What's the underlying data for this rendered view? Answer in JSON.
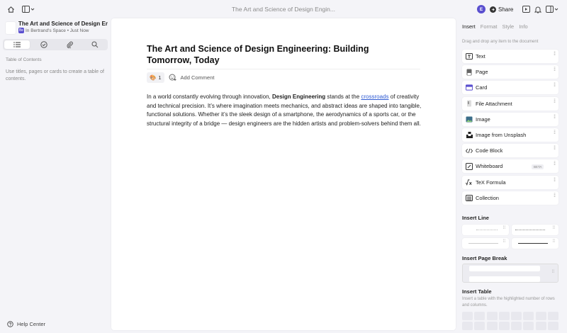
{
  "topbar": {
    "doc_title": "The Art and Science of Design Engin...",
    "avatar_letter": "E",
    "share_label": "Share"
  },
  "sidebar": {
    "doc_name": "The Art and Science of Design Eng...",
    "space_badge": "Be",
    "doc_meta": "In Bertrand's Space • Just Now",
    "toc_title": "Table of Contents",
    "toc_empty": "Use titles, pages or cards to create a table of contents.",
    "help_label": "Help Center"
  },
  "editor": {
    "title": "The Art and Science of Design Engineering: Building Tomorrow, Today",
    "reaction_emoji": "🎨",
    "reaction_count": "1",
    "add_comment": "Add Comment",
    "para_1": "In a world constantly evolving through innovation, ",
    "para_bold": "Design Engineering",
    "para_2": " stands at the ",
    "para_link": "crossroads",
    "para_3": " of creativity and technical precision. It’s where imagination meets mechanics, and abstract ideas are shaped into tangible, functional solutions. Whether it’s the sleek design of a smartphone, the aerodynamics of a sports car, or the structural integrity of a bridge — design engineers are the hidden artists and problem-solvers behind them all."
  },
  "panel": {
    "tabs": [
      "Insert",
      "Format",
      "Style",
      "Info"
    ],
    "hint": "Drag and drop any item to the document",
    "items": [
      {
        "label": "Text",
        "icon": "text-icon"
      },
      {
        "label": "Page",
        "icon": "page-icon"
      },
      {
        "label": "Card",
        "icon": "card-icon"
      },
      {
        "label": "File Attachment",
        "icon": "paperclip-icon"
      },
      {
        "label": "Image",
        "icon": "image-icon"
      },
      {
        "label": "Image from Unsplash",
        "icon": "unsplash-icon"
      },
      {
        "label": "Code Block",
        "icon": "code-icon"
      },
      {
        "label": "Whiteboard",
        "icon": "whiteboard-icon"
      },
      {
        "label": "TeX Formula",
        "icon": "formula-icon"
      },
      {
        "label": "Collection",
        "icon": "collection-icon"
      }
    ],
    "whiteboard_badge": "BETA",
    "insert_line": "Insert Line",
    "insert_page_break": "Insert Page Break",
    "insert_table": "Insert Table",
    "table_hint": "Insert a table with the highlighted number of rows and columns."
  }
}
